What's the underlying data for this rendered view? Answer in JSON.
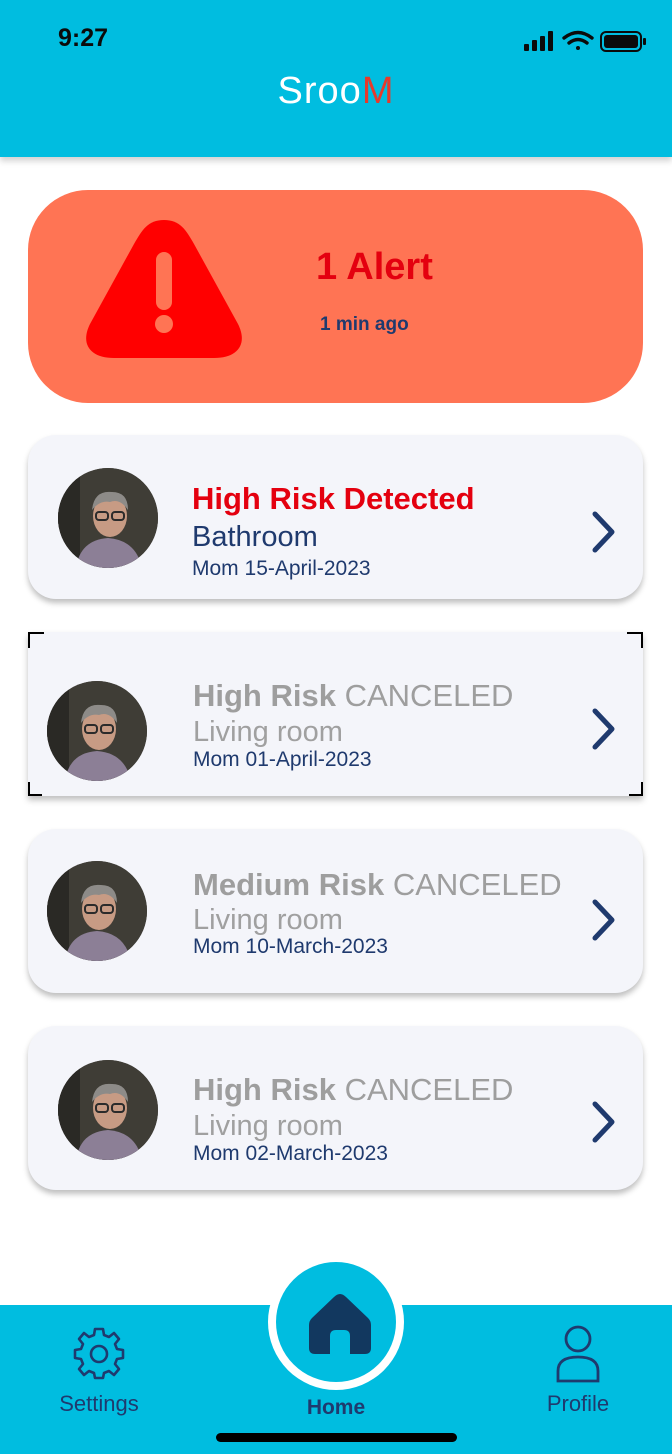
{
  "status_bar": {
    "time": "9:27"
  },
  "header": {
    "logo_main": "Sroo",
    "logo_accent": "M"
  },
  "alert": {
    "count_label": "1 Alert",
    "time_ago": "1 min ago"
  },
  "cards": [
    {
      "risk": "High Risk Detected",
      "status": "",
      "location": "Bathroom",
      "person": "Mom",
      "date": "15-April-2023"
    },
    {
      "risk": "High Risk",
      "status": "CANCELED",
      "location": "Living room",
      "person": "Mom",
      "date": "01-April-2023"
    },
    {
      "risk": "Medium Risk",
      "status": "CANCELED",
      "location": "Living room",
      "person": "Mom",
      "date": "10-March-2023"
    },
    {
      "risk": "High Risk",
      "status": "CANCELED",
      "location": "Living room",
      "person": "Mom",
      "date": "02-March-2023"
    }
  ],
  "nav": {
    "settings_label": "Settings",
    "home_label": "Home",
    "profile_label": "Profile"
  },
  "colors": {
    "brand": "#00bde0",
    "alert_bg": "#ff7454",
    "alert_red": "#e4000f",
    "navy": "#1f3a6e",
    "muted": "#9e9e9e"
  },
  "icons": [
    "cellular-signal-icon",
    "wifi-icon",
    "battery-icon",
    "warning-triangle-icon",
    "chevron-right-icon",
    "gear-icon",
    "home-icon",
    "user-icon"
  ]
}
